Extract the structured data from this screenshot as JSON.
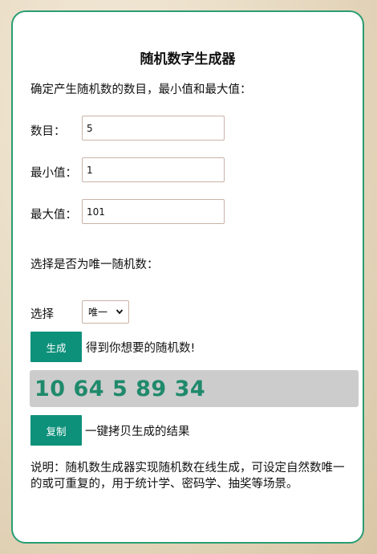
{
  "header": {
    "title": "随机数字生成器"
  },
  "form": {
    "instructions": "确定产生随机数的数目，最小值和最大值：",
    "count_label": "数目：",
    "count_value": "5",
    "min_label": "最小值：",
    "min_value": "1",
    "max_label": "最大值：",
    "max_value": "101",
    "unique_prompt": "选择是否为唯一随机数：",
    "choice_label": "选择",
    "choice_selected": "唯一"
  },
  "actions": {
    "generate_label": "生成",
    "generate_hint": "得到你想要的随机数!",
    "copy_label": "复制",
    "copy_hint": "一键拷贝生成的结果"
  },
  "result": {
    "numbers": "10 64 5 89 34"
  },
  "description": "说明：随机数生成器实现随机数在线生成，可设定自然数唯一的或可重复的，用于统计学、密码学、抽奖等场景。",
  "colors": {
    "accent": "#0e917b",
    "border": "#2a9d73",
    "result_text": "#1f8a6b",
    "result_bg": "#cccccc"
  },
  "icons": {
    "select_arrow": "chevron-down-icon"
  }
}
